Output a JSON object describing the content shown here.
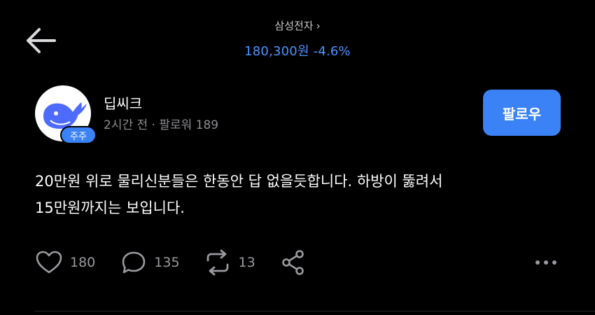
{
  "header": {
    "stock_name": "삼성전자",
    "chevron": "›",
    "price": "180,300원",
    "change": "-4.6%",
    "back_icon": "arrow-left-icon"
  },
  "post": {
    "author_name": "딥씨크",
    "author_meta": "2시간 전 · 팔로워 189",
    "holder_badge": "주주",
    "follow_label": "팔로우",
    "body_line1": "20만원 위로 물리신분들은 한동안 답 없을듯합니다. 하방이 뚫려서",
    "body_line2": "15만원까지는 보입니다."
  },
  "actions": {
    "likes": "180",
    "comments": "135",
    "reposts": "13"
  },
  "colors": {
    "background": "#000000",
    "accent_blue": "#3b82f6",
    "price_blue": "#4d94ff",
    "muted_text": "#8e8e93"
  }
}
